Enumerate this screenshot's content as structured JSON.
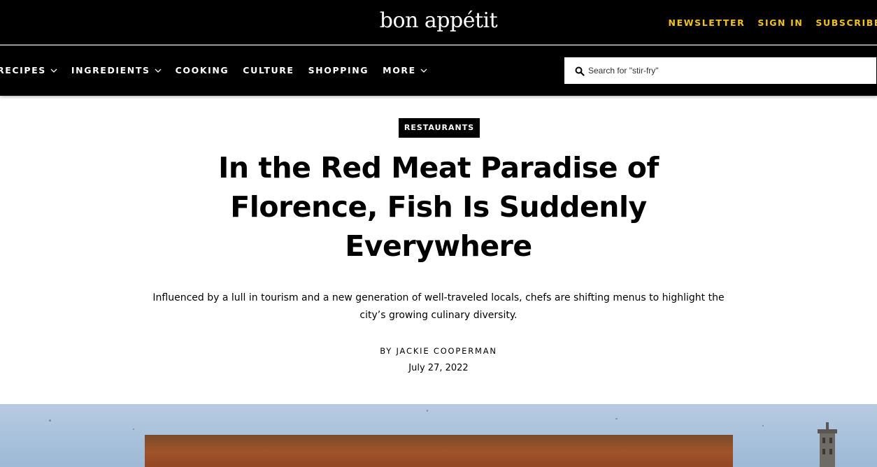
{
  "brand": {
    "logo_text": "bon appétit"
  },
  "top_links": [
    "NEWSLETTER",
    "SIGN IN",
    "SUBSCRIBE"
  ],
  "nav": {
    "items": [
      {
        "label": "RECIPES",
        "has_dropdown": true
      },
      {
        "label": "INGREDIENTS",
        "has_dropdown": true
      },
      {
        "label": "COOKING",
        "has_dropdown": false
      },
      {
        "label": "CULTURE",
        "has_dropdown": false
      },
      {
        "label": "SHOPPING",
        "has_dropdown": false
      },
      {
        "label": "MORE",
        "has_dropdown": true
      }
    ]
  },
  "search": {
    "placeholder": "Search for \"stir-fry\"",
    "value": "",
    "icon": "search-icon"
  },
  "article": {
    "rubric": "RESTAURANTS",
    "headline": "In the Red Meat Paradise of Florence, Fish Is Suddenly Everywhere",
    "dek": "Influenced by a lull in tourism and a new generation of well-traveled locals, chefs are shifting menus to highlight the city’s growing culinary diversity.",
    "byline_prefix": "BY ",
    "author": "JACKIE COOPERMAN",
    "date": "July 27, 2022"
  },
  "colors": {
    "accent": "#f2c21b",
    "nav_background": "#000000",
    "page_background": "#ffffff"
  }
}
